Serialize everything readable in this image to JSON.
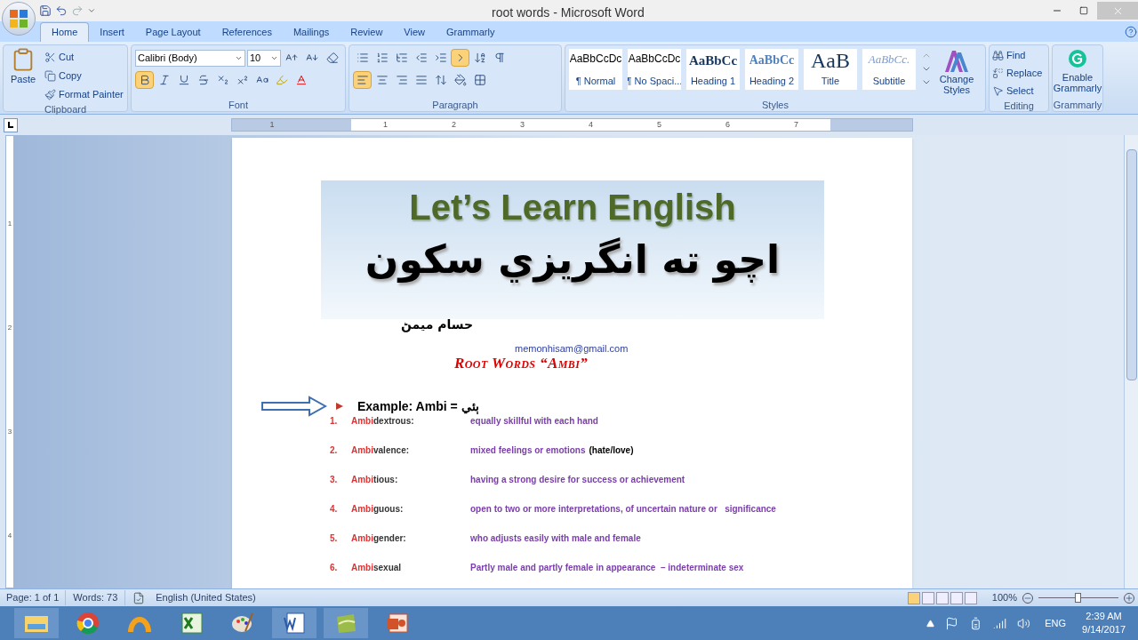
{
  "window": {
    "title": "root words - Microsoft Word"
  },
  "tabs": [
    {
      "label": "Home",
      "selected": true
    },
    {
      "label": "Insert",
      "selected": false
    },
    {
      "label": "Page Layout",
      "selected": false
    },
    {
      "label": "References",
      "selected": false
    },
    {
      "label": "Mailings",
      "selected": false
    },
    {
      "label": "Review",
      "selected": false
    },
    {
      "label": "View",
      "selected": false
    },
    {
      "label": "Grammarly",
      "selected": false
    }
  ],
  "ribbon": {
    "clipboard": {
      "label": "Clipboard",
      "paste": "Paste",
      "actions": [
        {
          "label": "Cut",
          "kind": "cut"
        },
        {
          "label": "Copy",
          "kind": "copy"
        },
        {
          "label": "Format Painter",
          "kind": "painter"
        }
      ]
    },
    "font": {
      "label": "Font",
      "name": "Calibri (Body)",
      "size": "10",
      "bold": true
    },
    "paragraph": {
      "label": "Paragraph",
      "align_left": true,
      "ltr": true
    },
    "styles": {
      "label": "Styles",
      "change": "Change Styles",
      "items": [
        {
          "preview": "AaBbCcDc",
          "name": "¶ Normal",
          "kind": "normal"
        },
        {
          "preview": "AaBbCcDc",
          "name": "¶ No Spaci...",
          "kind": "normal"
        },
        {
          "preview": "AaBbCc",
          "name": "Heading 1",
          "kind": "heading1"
        },
        {
          "preview": "AaBbCc",
          "name": "Heading 2",
          "kind": "heading2"
        },
        {
          "preview": "AaB",
          "name": "Title",
          "kind": "title"
        },
        {
          "preview": "AaBbCc.",
          "name": "Subtitle",
          "kind": "subtitle"
        }
      ]
    },
    "editing": {
      "label": "Editing",
      "actions": [
        {
          "label": "Find",
          "kind": "find"
        },
        {
          "label": "Replace",
          "kind": "replace"
        },
        {
          "label": "Select",
          "kind": "select"
        }
      ]
    },
    "grammarly": {
      "label": "Grammarly",
      "action": "Enable Grammarly"
    }
  },
  "ruler": {
    "labels": [
      "1",
      "1",
      "2",
      "3",
      "4",
      "5",
      "6",
      "7"
    ]
  },
  "vertical_ruler": {
    "labels": [
      "1",
      "2",
      "3",
      "4"
    ]
  },
  "document": {
    "banner_title": "Let’s Learn English",
    "banner_subtitle": "اچو ته انگريزي سکون",
    "author": "حسام ميمڻ",
    "email": "memonhisam@gmail.com",
    "heading": "Root Words “Ambi”",
    "example": "Example: Ambi = ٻئي",
    "entries": [
      {
        "number": "1.",
        "prefix": "Ambi",
        "rest": "dextrous:",
        "meaning": "equally skillful with each hand"
      },
      {
        "number": "2.",
        "prefix": "Ambi",
        "rest": "valence:",
        "meaning": "mixed feelings or emotions",
        "note": "(hate/love)"
      },
      {
        "number": "3.",
        "prefix": "Ambi",
        "rest": "tious:",
        "meaning": "having a strong desire for success or achievement"
      },
      {
        "number": "4.",
        "prefix": "Ambi",
        "rest": "guous:",
        "meaning": "open to two or more interpretations, of uncertain nature or   significance"
      },
      {
        "number": "5.",
        "prefix": "Ambi",
        "rest": "gender:",
        "meaning": "who adjusts easily with male and female"
      },
      {
        "number": "6.",
        "prefix": "Ambi",
        "rest": "sexual",
        "meaning": "Partly male and partly female in appearance  – indeterminate sex"
      }
    ]
  },
  "status_bar": {
    "page": "Page: 1 of 1",
    "words": "Words: 73",
    "language": "English (United States)",
    "zoom": "100%",
    "zoom_level": {
      "level": 0.5
    }
  },
  "taskbar": {
    "language": "ENG",
    "time": "2:39 AM",
    "date": "9/14/2017"
  }
}
